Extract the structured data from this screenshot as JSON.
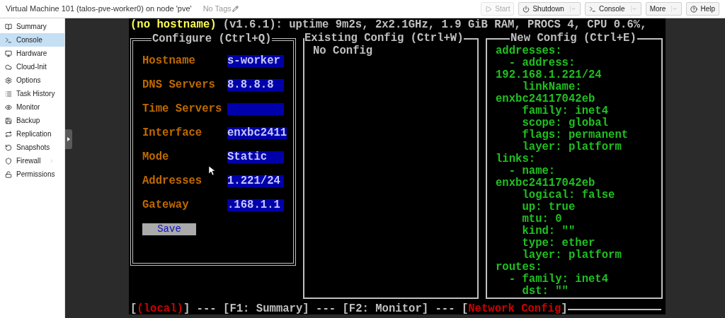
{
  "header": {
    "title": "Virtual Machine 101 (talos-pve-worker0) on node 'pve'",
    "tags": "No Tags"
  },
  "toolbar": [
    {
      "label": "Start",
      "kind": "start",
      "disabled": true
    },
    {
      "label": "Shutdown",
      "kind": "shutdown",
      "disabled": false,
      "menu": true
    },
    {
      "label": "Console",
      "kind": "console",
      "disabled": false,
      "menu": true
    },
    {
      "label": "More",
      "kind": "more",
      "disabled": false,
      "menu": true
    },
    {
      "label": "Help",
      "kind": "help",
      "disabled": false
    }
  ],
  "sidebar": {
    "items": [
      {
        "label": "Summary",
        "kind": "summary",
        "selected": false
      },
      {
        "label": "Console",
        "kind": "console",
        "selected": true
      },
      {
        "label": "Hardware",
        "kind": "hardware",
        "selected": false
      },
      {
        "label": "Cloud-Init",
        "kind": "cloud",
        "selected": false
      },
      {
        "label": "Options",
        "kind": "options",
        "selected": false
      },
      {
        "label": "Task History",
        "kind": "tasks",
        "selected": false
      },
      {
        "label": "Monitor",
        "kind": "monitor",
        "selected": false
      },
      {
        "label": "Backup",
        "kind": "backup",
        "selected": false
      },
      {
        "label": "Replication",
        "kind": "replication",
        "selected": false
      },
      {
        "label": "Snapshots",
        "kind": "snapshots",
        "selected": false
      },
      {
        "label": "Firewall",
        "kind": "firewall",
        "selected": false,
        "submenu": true
      },
      {
        "label": "Permissions",
        "kind": "permissions",
        "selected": false
      }
    ]
  },
  "terminal": {
    "hostname": "(no hostname)",
    "status": "(v1.6.1): uptime 9m2s, 2x2.1GHz, 1.9 GiB RAM, PROCS 4, CPU 0.6%,",
    "configure": {
      "title": "Configure (Ctrl+Q)",
      "fields": [
        {
          "label": "Hostname",
          "value": "s-worker"
        },
        {
          "label": "DNS Servers",
          "value": "8.8.8.8"
        },
        {
          "label": "Time Servers"
        },
        {
          "label": "Interface",
          "value": "enxbc2411"
        },
        {
          "label": "Mode",
          "value": "Static"
        },
        {
          "label": "Addresses",
          "value": "1.221/24"
        },
        {
          "label": "Gateway",
          "value": ".168.1.1"
        }
      ],
      "save": "Save"
    },
    "existing": {
      "title": "Existing Config (Ctrl+W)",
      "text": "No Config"
    },
    "new_config": {
      "title": "New Config (Ctrl+E)",
      "lines": [
        "addresses:",
        "  - address:",
        "192.168.1.221/24",
        "    linkName:",
        "enxbc24117042eb",
        "    family: inet4",
        "    scope: global",
        "    flags: permanent",
        "    layer: platform",
        "links:",
        "  - name:",
        "enxbc24117042eb",
        "    logical: false",
        "    up: true",
        "    mtu: 0",
        "    kind: \"\"",
        "    type: ether",
        "    layer: platform",
        "routes:",
        "  - family: inet4",
        "    dst: \"\""
      ]
    },
    "footer": [
      {
        "text": "[",
        "highlighted": false
      },
      {
        "text": "(local)",
        "highlighted": true
      },
      {
        "text": "] --- [F1: Summary] --- [F2: Monitor] --- [",
        "highlighted": false
      },
      {
        "text": "Network Config",
        "highlighted": true
      },
      {
        "text": "]",
        "highlighted": false
      }
    ]
  }
}
